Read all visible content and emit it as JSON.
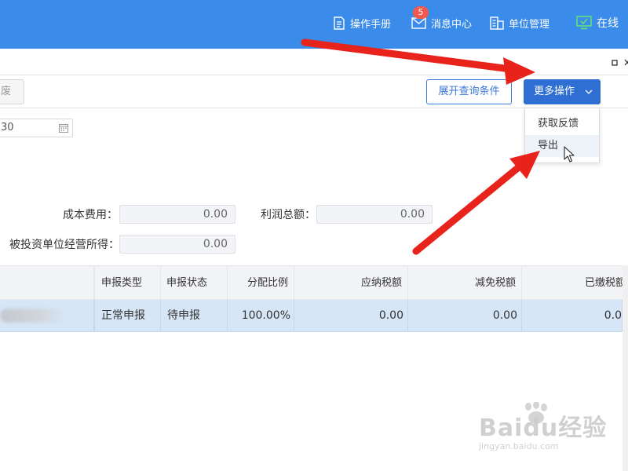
{
  "header": {
    "manual_label": "操作手册",
    "messages_label": "消息中心",
    "messages_badge": "5",
    "org_label": "单位管理",
    "online_label": "在线"
  },
  "toolbar": {
    "void_label": "废",
    "expand_label": "展开查询条件",
    "more_label": "更多操作",
    "menu": {
      "feedback_label": "获取反馈",
      "export_label": "导出"
    }
  },
  "filters": {
    "date_value": "30"
  },
  "form": {
    "cost_label": "成本费用：",
    "cost_value": "0.00",
    "profit_label": "利润总额：",
    "profit_value": "0.00",
    "investee_label": "被投资单位经营所得：",
    "investee_value": "0.00"
  },
  "table": {
    "headers": {
      "type": "申报类型",
      "status": "申报状态",
      "ratio": "分配比例",
      "payable": "应纳税额",
      "relief": "减免税额",
      "paid": "已缴税额"
    },
    "rows": [
      {
        "type": "正常申报",
        "status": "待申报",
        "ratio": "100.00%",
        "payable": "0.00",
        "relief": "0.00",
        "paid": "0.0"
      }
    ]
  },
  "watermark": {
    "main": "Baidu经验",
    "sub": "jingyan.baidu.com"
  },
  "colors": {
    "header_bg": "#3b8cea",
    "primary_button": "#2f6fd4",
    "row_selected": "#d7e6f6",
    "annotation_arrow": "#e8231b",
    "badge": "#ef5a4c"
  }
}
